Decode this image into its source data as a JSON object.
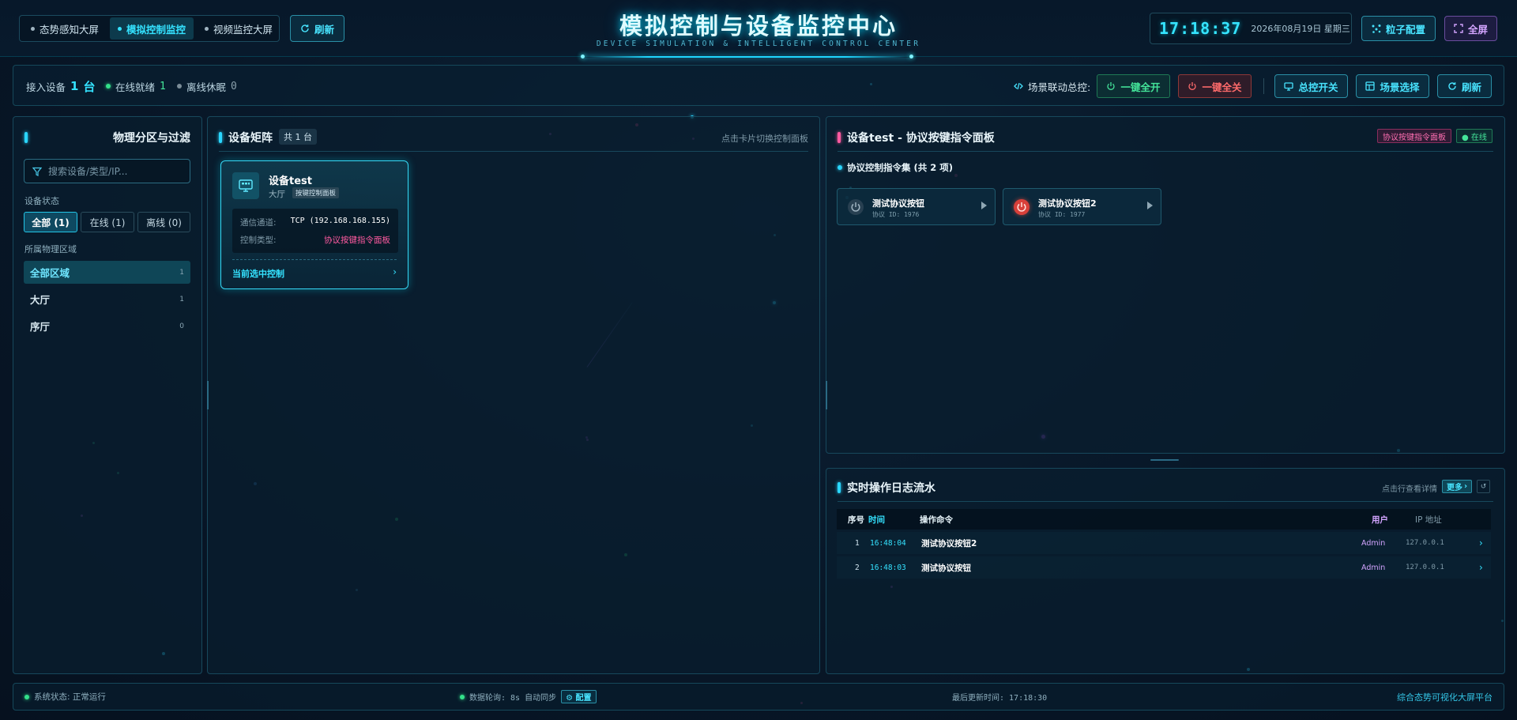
{
  "header": {
    "nav_tabs": [
      {
        "label": "态势感知大屏",
        "active": false
      },
      {
        "label": "模拟控制监控",
        "active": true
      },
      {
        "label": "视频监控大屏",
        "active": false
      }
    ],
    "refresh_label": "刷新",
    "title": "模拟控制与设备监控中心",
    "subtitle": "DEVICE SIMULATION & INTELLIGENT CONTROL CENTER",
    "clock_time": "17:18:37",
    "clock_date": "2026年08月19日 星期三",
    "particle_config_label": "粒子配置",
    "fullscreen_label": "全屏"
  },
  "toolbar": {
    "connected_label": "接入设备",
    "connected_count": "1",
    "connected_unit": "台",
    "online_label": "在线就绪",
    "online_count": "1",
    "offline_label": "离线休眠",
    "offline_count": "0",
    "scene_master_label": "场景联动总控:",
    "all_on_label": "一键全开",
    "all_off_label": "一键全关",
    "master_switch_label": "总控开关",
    "scene_select_label": "场景选择",
    "refresh_label": "刷新"
  },
  "sidebar": {
    "title": "物理分区与过滤",
    "search_placeholder": "搜索设备/类型/IP...",
    "status_label": "设备状态",
    "status_filters": [
      {
        "label": "全部 (1)",
        "active": true
      },
      {
        "label": "在线 (1)",
        "active": false
      },
      {
        "label": "离线 (0)",
        "active": false
      }
    ],
    "zone_label": "所属物理区域",
    "zones": [
      {
        "label": "全部区域",
        "count": "1",
        "active": true
      },
      {
        "label": "大厅",
        "count": "1",
        "active": false
      },
      {
        "label": "序厅",
        "count": "0",
        "active": false
      }
    ]
  },
  "matrix": {
    "title": "设备矩阵",
    "count_badge": "共 1 台",
    "hint": "点击卡片切换控制面板",
    "card": {
      "name": "设备test",
      "zone": "大厅",
      "tag": "按键控制面板",
      "channel_label": "通信通道:",
      "channel_value": "TCP (192.168.168.155)",
      "type_label": "控制类型:",
      "type_value": "协议按键指令面板",
      "selected_label": "当前选中控制",
      "arrow": "›"
    }
  },
  "control_panel": {
    "title": "设备test - 协议按键指令面板",
    "type_badge": "协议按键指令面板",
    "status_badge": "● 在线",
    "section_title": "协议控制指令集 (共 2 项)",
    "commands": [
      {
        "name": "测试协议按钮",
        "id": "协议 ID: 1976",
        "active": false
      },
      {
        "name": "测试协议按钮2",
        "id": "协议 ID: 1977",
        "active": true
      }
    ]
  },
  "log": {
    "title": "实时操作日志流水",
    "hint": "点击行查看详情",
    "more_label": "更多",
    "more_arrow": "›",
    "refresh_icon_text": "↺",
    "columns": {
      "index": "序号",
      "time": "时间",
      "command": "操作命令",
      "user": "用户",
      "ip": "IP 地址"
    },
    "rows": [
      {
        "index": "1",
        "time": "16:48:04",
        "command": "测试协议按钮2",
        "user": "Admin",
        "ip": "127.0.0.1",
        "arrow": "›"
      },
      {
        "index": "2",
        "time": "16:48:03",
        "command": "测试协议按钮",
        "user": "Admin",
        "ip": "127.0.0.1",
        "arrow": "›"
      }
    ]
  },
  "footer": {
    "system_status": "系统状态: 正常运行",
    "polling": "数据轮询: 8s 自动同步",
    "config_label": "⚙ 配置",
    "last_update": "最后更新时间: 17:18:30",
    "platform": "综合态势可视化大屏平台"
  },
  "colors": {
    "accent_cyan": "#34e2ff",
    "online_green": "#44e59a",
    "danger_red": "#ff6b6b",
    "accent_purple": "#d3a4ff",
    "accent_pink": "#ff5aa0"
  }
}
